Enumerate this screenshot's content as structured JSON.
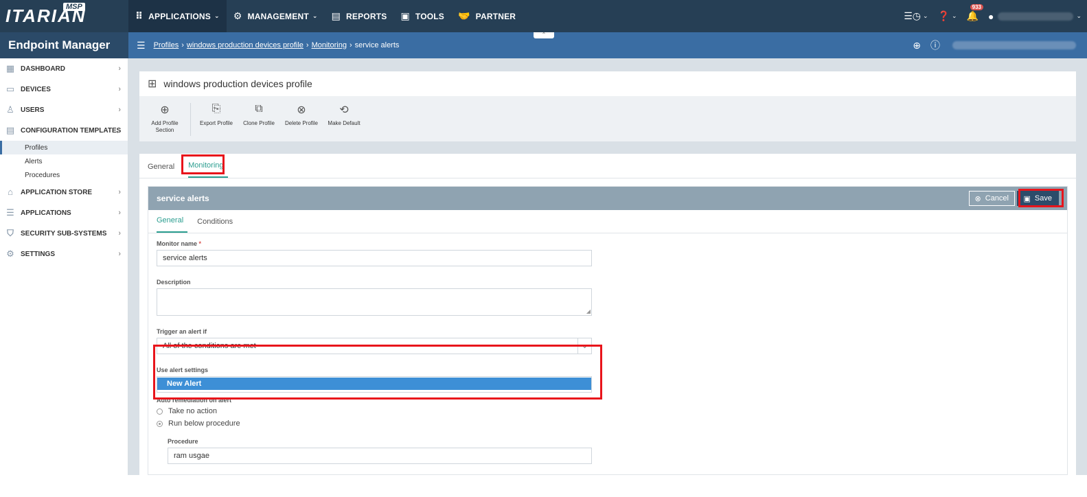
{
  "app": {
    "brand": "ITARIAN",
    "msp": "MSP",
    "title": "Endpoint Manager"
  },
  "topnav": [
    {
      "label": "APPLICATIONS",
      "icon": "grid-icon",
      "glyph": "⠿",
      "caret": "⌄"
    },
    {
      "label": "MANAGEMENT",
      "icon": "gears-icon",
      "glyph": "⚙",
      "caret": "⌄"
    },
    {
      "label": "REPORTS",
      "icon": "report-icon",
      "glyph": "▤",
      "caret": ""
    },
    {
      "label": "TOOLS",
      "icon": "toolbox-icon",
      "glyph": "▣",
      "caret": ""
    },
    {
      "label": "PARTNER",
      "icon": "handshake-icon",
      "glyph": "🤝",
      "caret": ""
    }
  ],
  "topright": {
    "notifications": "933"
  },
  "breadcrumb": [
    "Profiles",
    "windows production devices profile",
    "Monitoring",
    "service alerts"
  ],
  "sidebar": {
    "items": [
      {
        "label": "DASHBOARD",
        "icon": "dashboard-icon",
        "glyph": "▦"
      },
      {
        "label": "DEVICES",
        "icon": "devices-icon",
        "glyph": "▭"
      },
      {
        "label": "USERS",
        "icon": "user-icon",
        "glyph": "♙"
      },
      {
        "label": "CONFIGURATION TEMPLATES",
        "icon": "template-icon",
        "glyph": "▤"
      },
      {
        "label": "APPLICATION STORE",
        "icon": "store-icon",
        "glyph": "⌂"
      },
      {
        "label": "APPLICATIONS",
        "icon": "applications-icon",
        "glyph": "☰"
      },
      {
        "label": "SECURITY SUB-SYSTEMS",
        "icon": "shield-icon",
        "glyph": "⛉"
      },
      {
        "label": "SETTINGS",
        "icon": "gear-icon",
        "glyph": "⚙"
      }
    ],
    "subitems": [
      "Profiles",
      "Alerts",
      "Procedures"
    ]
  },
  "profile": {
    "title": "windows production devices profile"
  },
  "toolbar": [
    {
      "label": "Add Profile Section",
      "icon": "add-section-icon",
      "glyph": "⊕"
    },
    {
      "label": "Export Profile",
      "icon": "export-icon",
      "glyph": "⎘"
    },
    {
      "label": "Clone Profile",
      "icon": "clone-icon",
      "glyph": "⧉"
    },
    {
      "label": "Delete Profile",
      "icon": "delete-icon",
      "glyph": "⊗"
    },
    {
      "label": "Make Default",
      "icon": "default-icon",
      "glyph": "⟲"
    }
  ],
  "tabs": [
    "General",
    "Monitoring"
  ],
  "monitor": {
    "title": "service alerts",
    "cancel": "Cancel",
    "save": "Save",
    "inner_tabs": [
      "General",
      "Conditions"
    ],
    "fields": {
      "monitor_name_label": "Monitor name",
      "monitor_name_value": "service alerts",
      "description_label": "Description",
      "trigger_label": "Trigger an alert if",
      "trigger_value": "All of the conditions are met",
      "alert_settings_label": "Use alert settings",
      "alert_settings_value": "new",
      "dropdown_option": "New Alert",
      "auto_remediation_label": "Auto remediation on alert",
      "radio_no_action": "Take no action",
      "radio_run_procedure": "Run below procedure",
      "procedure_label": "Procedure",
      "procedure_value": "ram usgae"
    }
  },
  "colors": {
    "topbar": "#263f55",
    "subbar": "#3a6da3",
    "accent": "#2a9d8f",
    "highlight": "#e8141b",
    "dropdown": "#3d8fd6"
  }
}
